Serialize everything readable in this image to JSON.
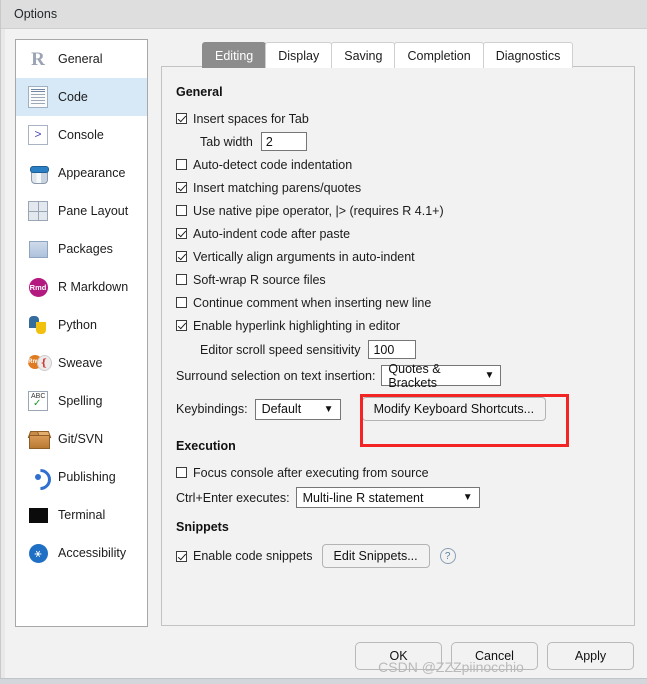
{
  "window": {
    "title": "Options"
  },
  "sidebar": {
    "items": [
      {
        "label": "General",
        "icon": "r-logo-icon",
        "selected": false
      },
      {
        "label": "Code",
        "icon": "code-document-icon",
        "selected": true
      },
      {
        "label": "Console",
        "icon": "console-prompt-icon",
        "selected": false
      },
      {
        "label": "Appearance",
        "icon": "paint-bucket-icon",
        "selected": false
      },
      {
        "label": "Pane Layout",
        "icon": "pane-grid-icon",
        "selected": false
      },
      {
        "label": "Packages",
        "icon": "package-box-icon",
        "selected": false
      },
      {
        "label": "R Markdown",
        "icon": "rmd-badge-icon",
        "selected": false
      },
      {
        "label": "Python",
        "icon": "python-logo-icon",
        "selected": false
      },
      {
        "label": "Sweave",
        "icon": "sweave-pdf-icon",
        "selected": false
      },
      {
        "label": "Spelling",
        "icon": "spell-check-icon",
        "selected": false
      },
      {
        "label": "Git/SVN",
        "icon": "git-box-icon",
        "selected": false
      },
      {
        "label": "Publishing",
        "icon": "publish-orbit-icon",
        "selected": false
      },
      {
        "label": "Terminal",
        "icon": "terminal-icon",
        "selected": false
      },
      {
        "label": "Accessibility",
        "icon": "accessibility-icon",
        "selected": false
      }
    ]
  },
  "tabs": [
    {
      "label": "Editing",
      "active": true
    },
    {
      "label": "Display",
      "active": false
    },
    {
      "label": "Saving",
      "active": false
    },
    {
      "label": "Completion",
      "active": false
    },
    {
      "label": "Diagnostics",
      "active": false
    }
  ],
  "sections": {
    "general": {
      "heading": "General",
      "checkboxes": [
        {
          "label": "Insert spaces for Tab",
          "checked": true
        },
        {
          "label": "Auto-detect code indentation",
          "checked": false
        },
        {
          "label": "Insert matching parens/quotes",
          "checked": true
        },
        {
          "label": "Use native pipe operator, |> (requires R 4.1+)",
          "checked": false
        },
        {
          "label": "Auto-indent code after paste",
          "checked": true
        },
        {
          "label": "Vertically align arguments in auto-indent",
          "checked": true
        },
        {
          "label": "Soft-wrap R source files",
          "checked": false
        },
        {
          "label": "Continue comment when inserting new line",
          "checked": false
        },
        {
          "label": "Enable hyperlink highlighting in editor",
          "checked": true
        }
      ],
      "tab_width": {
        "label": "Tab width",
        "value": "2"
      },
      "scroll_speed": {
        "label": "Editor scroll speed sensitivity",
        "value": "100"
      },
      "surround": {
        "label": "Surround selection on text insertion:",
        "value": "Quotes & Brackets"
      },
      "keybindings": {
        "label": "Keybindings:",
        "value": "Default"
      },
      "modify_shortcuts_button": "Modify Keyboard Shortcuts..."
    },
    "execution": {
      "heading": "Execution",
      "focus_console": {
        "label": "Focus console after executing from source",
        "checked": false
      },
      "ctrl_enter": {
        "label": "Ctrl+Enter executes:",
        "value": "Multi-line R statement"
      }
    },
    "snippets": {
      "heading": "Snippets",
      "enable": {
        "label": "Enable code snippets",
        "checked": true
      },
      "edit_button": "Edit Snippets...",
      "help_glyph": "?"
    }
  },
  "footer": {
    "ok": "OK",
    "cancel": "Cancel",
    "apply": "Apply"
  },
  "watermark": {
    "text": "CSDN @ZZZpiinocchio"
  },
  "colors": {
    "highlight_rect": "#f22424",
    "selected_item_bg": "#d7e8f7",
    "active_tab_bg": "#8c8c8c"
  }
}
